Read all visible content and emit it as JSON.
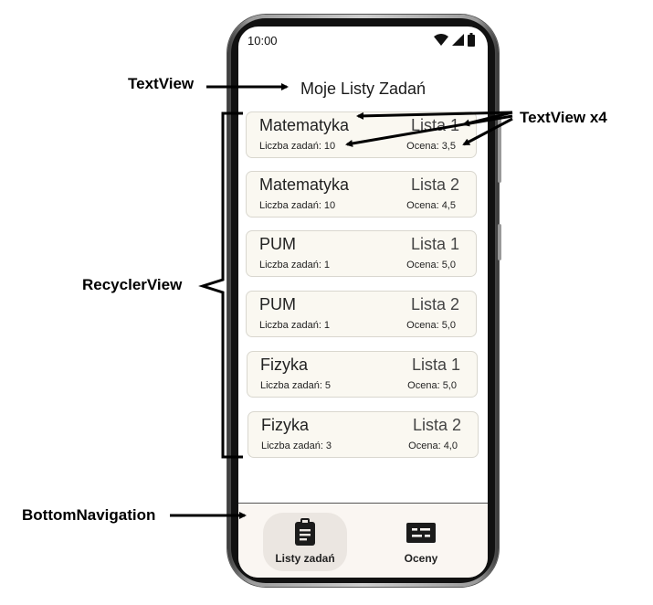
{
  "status_bar": {
    "time": "10:00"
  },
  "header": {
    "title": "Moje Listy Zadań"
  },
  "task_lists": [
    {
      "subject": "Matematyka",
      "list": "Lista 1",
      "count": "Liczba zadań: 10",
      "grade": "Ocena: 3,5"
    },
    {
      "subject": "Matematyka",
      "list": "Lista 2",
      "count": "Liczba zadań: 10",
      "grade": "Ocena: 4,5"
    },
    {
      "subject": "PUM",
      "list": "Lista 1",
      "count": "Liczba zadań: 1",
      "grade": "Ocena: 5,0"
    },
    {
      "subject": "PUM",
      "list": "Lista 2",
      "count": "Liczba zadań: 1",
      "grade": "Ocena: 5,0"
    },
    {
      "subject": "Fizyka",
      "list": "Lista 1",
      "count": "Liczba zadań: 5",
      "grade": "Ocena: 5,0"
    },
    {
      "subject": "Fizyka",
      "list": "Lista 2",
      "count": "Liczba zadań: 3",
      "grade": "Ocena: 4,0"
    }
  ],
  "bottom_nav": {
    "items": [
      {
        "label": "Listy zadań",
        "icon": "clipboard-icon",
        "active": true
      },
      {
        "label": "Oceny",
        "icon": "grades-icon",
        "active": false
      }
    ]
  },
  "annotations": {
    "textview": "TextView",
    "textview_x4": "TextView x4",
    "recyclerview": "RecyclerView",
    "bottomnavigation": "BottomNavigation"
  },
  "colors": {
    "card_bg": "#faf8f1",
    "nav_bg": "#faf6f2",
    "nav_active": "#ebe6e1"
  }
}
